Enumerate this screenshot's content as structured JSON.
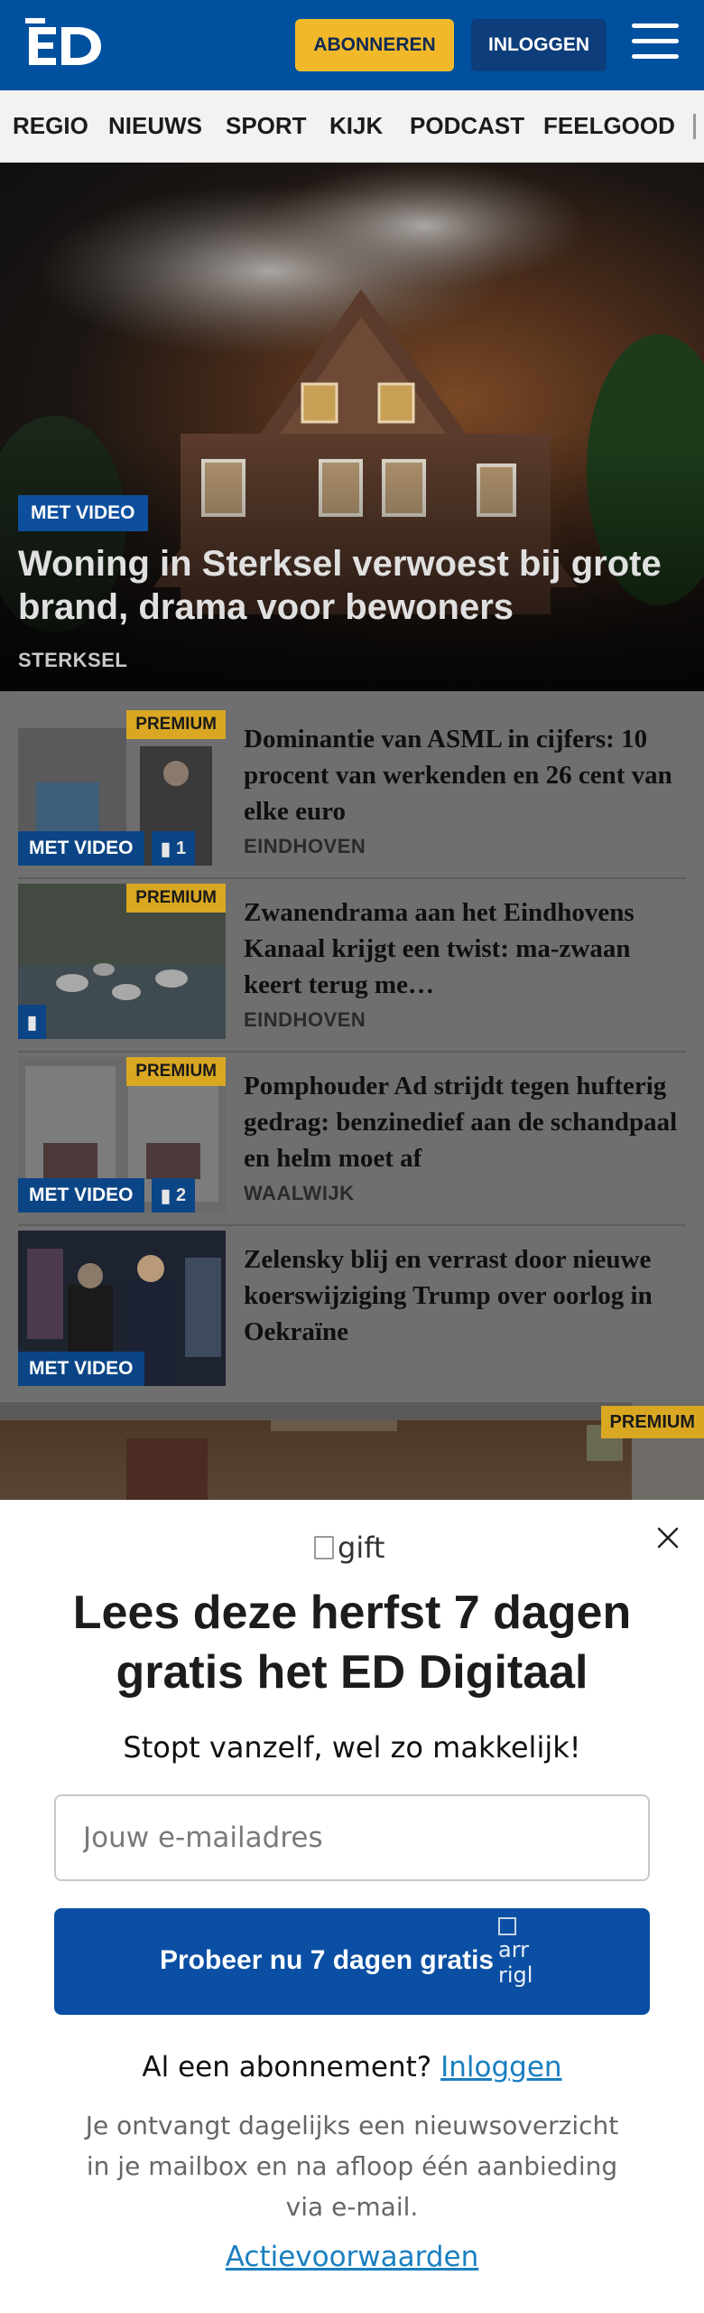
{
  "header": {
    "logo_text": "ED",
    "subscribe_label": "ABONNEREN",
    "login_label": "INLOGGEN",
    "menu_icon": "hamburger-menu-icon",
    "brand_color": "#0050a0",
    "accent_color": "#f1b92a"
  },
  "nav": {
    "items": [
      "REGIO",
      "NIEUWS",
      "SPORT",
      "KIJK",
      "PODCAST",
      "FEELGOOD"
    ]
  },
  "hero": {
    "badge": "MET VIDEO",
    "title": "Woning in Sterksel verwoest bij grote brand, drama voor bewoners",
    "location": "STERKSEL"
  },
  "articles": [
    {
      "premium": "PREMIUM",
      "video": "MET VIDEO",
      "comments": "1",
      "title": "Dominantie van ASML in cijfers: 10 procent van werkenden en 26 cent van elke euro",
      "location": "EINDHOVEN"
    },
    {
      "premium": "PREMIUM",
      "title": "Zwanendrama aan het Eindhovens Kanaal krijgt een twist: ma-zwaan keert terug me…",
      "location": "EINDHOVEN"
    },
    {
      "premium": "PREMIUM",
      "video": "MET VIDEO",
      "comments": "2",
      "title": "Pomphouder Ad strijdt tegen hufterig gedrag: benzinedief aan de schandpaal en helm moet af",
      "location": "WAALWIJK"
    },
    {
      "video": "MET VIDEO",
      "title": "Zelensky blij en verrast door nieuwe koerswijziging Trump over oorlog in Oekraïne"
    }
  ],
  "next_teaser": {
    "premium": "PREMIUM"
  },
  "modal": {
    "image_alt": "gift",
    "title": "Lees deze herfst 7 dagen gratis het ED Digitaal",
    "subtitle": "Stopt vanzelf, wel zo makkelijk!",
    "email_placeholder": "Jouw e-mailadres",
    "cta_label": "Probeer nu 7 dagen gratis",
    "cta_icon_alt_line1": "arr",
    "cta_icon_alt_line2": "rigl",
    "already_text": "Al een abonnement?",
    "login_link": "Inloggen",
    "note": "Je ontvangt dagelijks een nieuwsoverzicht in je mailbox en na afloop één aanbieding via e-mail.",
    "terms_link": "Actievoorwaarden",
    "close_icon": "close-icon"
  }
}
